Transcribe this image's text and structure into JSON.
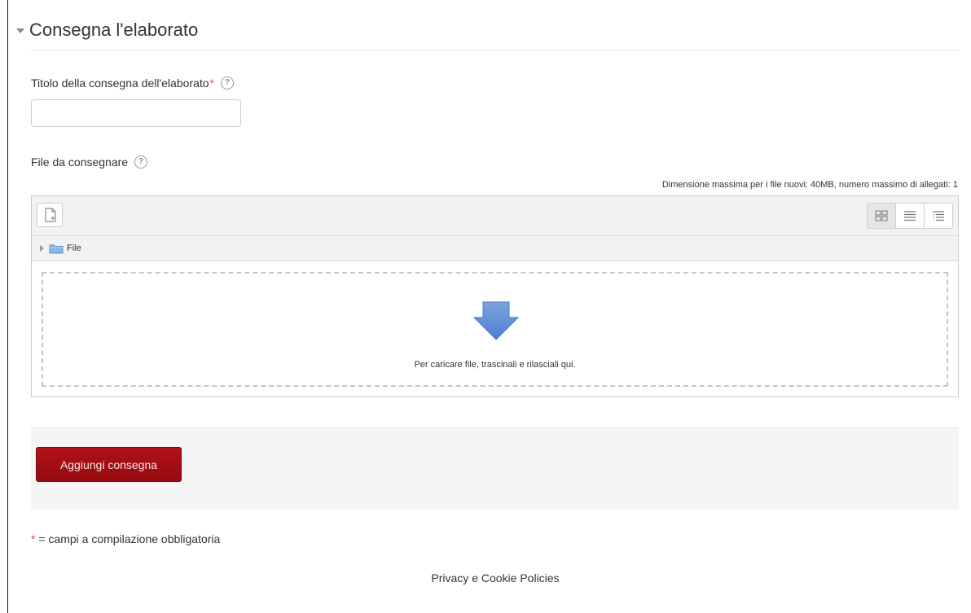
{
  "section": {
    "title": "Consegna l'elaborato"
  },
  "fields": {
    "title_label": "Titolo della consegna dell'elaborato",
    "title_required": "*",
    "title_value": "",
    "help_glyph": "?",
    "file_label": "File da consegnare"
  },
  "filemanager": {
    "max_size_note": "Dimensione massima per i file nuovi: 40MB, numero massimo di allegati: 1",
    "path_folder": "File",
    "drop_text": "Per caricare file, trascinali e rilasciali qui.",
    "icons": [
      "add-file-icon",
      "icons-view-icon",
      "list-view-icon",
      "tree-view-icon",
      "folder-icon",
      "download-arrow-icon"
    ]
  },
  "actions": {
    "submit_label": "Aggiungi consegna"
  },
  "footer": {
    "required_star": "*",
    "required_note": " = campi a compilazione obbligatoria",
    "privacy_link": "Privacy e Cookie Policies"
  },
  "colors": {
    "accent": "#a40d12",
    "required": "#d9534f",
    "arrow": "#5b8dd6"
  }
}
